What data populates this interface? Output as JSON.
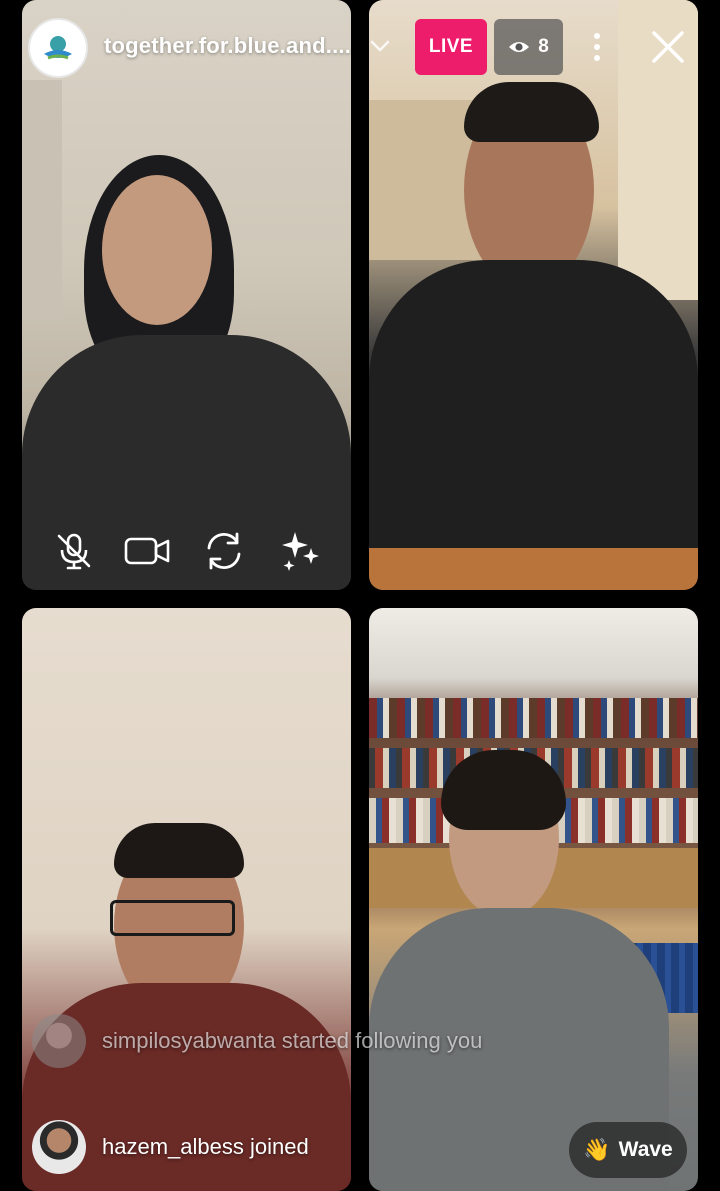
{
  "header": {
    "host_name": "together.for.blue.and....",
    "live_label": "LIVE",
    "viewer_count": "8",
    "live_color": "#ee1d6b"
  },
  "controls": {
    "mute_icon": "mic-off-icon",
    "camera_icon": "video-camera-icon",
    "flip_icon": "camera-flip-icon",
    "effects_icon": "sparkles-icon"
  },
  "notifications": [
    {
      "text": "simpilosyabwanta started following you",
      "dimmed": true
    },
    {
      "text": "hazem_albess joined",
      "dimmed": false
    }
  ],
  "wave": {
    "emoji": "👋",
    "label": "Wave"
  }
}
